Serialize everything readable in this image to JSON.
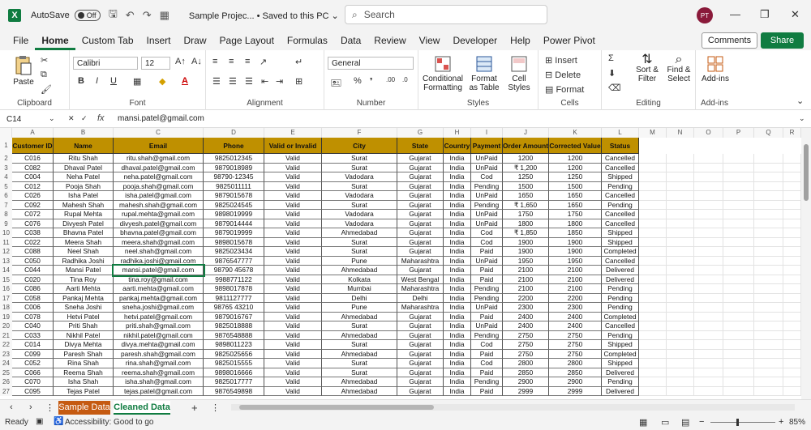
{
  "titlebar": {
    "app_logo": "X",
    "autosave_label": "AutoSave",
    "autosave_state": "Off",
    "doc_title": "Sample Projec... • Saved to this PC ⌄",
    "search_placeholder": "Search",
    "avatar_initials": "PT"
  },
  "tabs": [
    "File",
    "Home",
    "Custom Tab",
    "Insert",
    "Draw",
    "Page Layout",
    "Formulas",
    "Data",
    "Review",
    "View",
    "Developer",
    "Help",
    "Power Pivot"
  ],
  "active_tab": "Home",
  "comments_label": "Comments",
  "share_label": "Share",
  "ribbon": {
    "clipboard": {
      "paste": "Paste",
      "label": "Clipboard"
    },
    "font": {
      "name": "Calibri",
      "size": "12",
      "bold": "B",
      "italic": "I",
      "underline": "U",
      "font_color_letter": "A",
      "label": "Font"
    },
    "alignment": {
      "label": "Alignment"
    },
    "number": {
      "format": "General",
      "label": "Number"
    },
    "styles": {
      "conditional": "Conditional Formatting",
      "format_table": "Format as Table",
      "cell_styles": "Cell Styles",
      "label": "Styles"
    },
    "cells": {
      "insert": "Insert",
      "delete": "Delete",
      "format": "Format",
      "label": "Cells"
    },
    "editing": {
      "sort": "Sort & Filter",
      "find": "Find & Select",
      "label": "Editing"
    },
    "addins": {
      "addins": "Add-ins",
      "label": "Add-ins"
    }
  },
  "formula_bar": {
    "name_box": "C14",
    "fx": "fx",
    "content": "mansi.patel@gmail.com"
  },
  "columns": [
    "A",
    "B",
    "C",
    "D",
    "E",
    "F",
    "G",
    "H",
    "I",
    "J",
    "K",
    "L",
    "M",
    "N",
    "O",
    "P",
    "Q",
    "R"
  ],
  "headers": [
    "Customer ID",
    "Name",
    "Email",
    "Phone",
    "Valid or Invalid",
    "City",
    "State",
    "Country",
    "Payment",
    "Order Amount",
    "Corrected Value",
    "Status"
  ],
  "rows": [
    [
      "C016",
      "Ritu Shah",
      "ritu.shah@gmail.com",
      "9825012345",
      "Valid",
      "Surat",
      "Gujarat",
      "India",
      "UnPaid",
      "1200",
      "1200",
      "Cancelled"
    ],
    [
      "C082",
      "Dhaval Patel",
      "dhaval.patel@gmail.com",
      "9879018989",
      "Valid",
      "Surat",
      "Gujarat",
      "India",
      "UnPaid",
      "₹ 1,200",
      "1200",
      "Cancelled"
    ],
    [
      "C004",
      "Neha Patel",
      "neha.patel@gmail.com",
      "98790-12345",
      "Valid",
      "Vadodara",
      "Gujarat",
      "India",
      "Cod",
      "1250",
      "1250",
      "Shipped"
    ],
    [
      "C012",
      "Pooja Shah",
      "pooja.shah@gmail.com",
      "9825011111",
      "Valid",
      "Surat",
      "Gujarat",
      "India",
      "Pending",
      "1500",
      "1500",
      "Pending"
    ],
    [
      "C026",
      "Isha Patel",
      "isha.patel@gmail.com",
      "9879015678",
      "Valid",
      "Vadodara",
      "Gujarat",
      "India",
      "UnPaid",
      "1650",
      "1650",
      "Cancelled"
    ],
    [
      "C092",
      "Mahesh Shah",
      "mahesh.shah@gmail.com",
      "9825024545",
      "Valid",
      "Surat",
      "Gujarat",
      "India",
      "Pending",
      "₹ 1,650",
      "1650",
      "Pending"
    ],
    [
      "C072",
      "Rupal Mehta",
      "rupal.mehta@gmail.com",
      "9898019999",
      "Valid",
      "Vadodara",
      "Gujarat",
      "India",
      "UnPaid",
      "1750",
      "1750",
      "Cancelled"
    ],
    [
      "C076",
      "Divyesh Patel",
      "divyesh.patel@gmail.com",
      "9879014444",
      "Valid",
      "Vadodara",
      "Gujarat",
      "India",
      "UnPaid",
      "1800",
      "1800",
      "Cancelled"
    ],
    [
      "C038",
      "Bhavna Patel",
      "bhavna.patel@gmail.com",
      "9879019999",
      "Valid",
      "Ahmedabad",
      "Gujarat",
      "India",
      "Cod",
      "₹ 1,850",
      "1850",
      "Shipped"
    ],
    [
      "C022",
      "Meera Shah",
      "meera.shah@gmail.com",
      "9898015678",
      "Valid",
      "Surat",
      "Gujarat",
      "India",
      "Cod",
      "1900",
      "1900",
      "Shipped"
    ],
    [
      "C088",
      "Neel Shah",
      "neel.shah@gmail.com",
      "9825023434",
      "Valid",
      "Surat",
      "Gujarat",
      "India",
      "Paid",
      "1900",
      "1900",
      "Completed"
    ],
    [
      "C050",
      "Radhika Joshi",
      "radhika.joshi@gmail.com",
      "9876547777",
      "Valid",
      "Pune",
      "Maharashtra",
      "India",
      "UnPaid",
      "1950",
      "1950",
      "Cancelled"
    ],
    [
      "C044",
      "Mansi Patel",
      "mansi.patel@gmail.com",
      "98790 45678",
      "Valid",
      "Ahmedabad",
      "Gujarat",
      "India",
      "Paid",
      "2100",
      "2100",
      "Delivered"
    ],
    [
      "C020",
      "Tina Roy",
      "tina.roy@gmail.com",
      "9988771122",
      "Valid",
      "Kolkata",
      "West Bengal",
      "India",
      "Paid",
      "2100",
      "2100",
      "Delivered"
    ],
    [
      "C086",
      "Aarti Mehta",
      "aarti.mehta@gmail.com",
      "9898017878",
      "Valid",
      "Mumbai",
      "Maharashtra",
      "India",
      "Pending",
      "2100",
      "2100",
      "Pending"
    ],
    [
      "C058",
      "Pankaj Mehta",
      "pankaj.mehta@gmail.com",
      "9811127777",
      "Valid",
      "Delhi",
      "Delhi",
      "India",
      "Pending",
      "2200",
      "2200",
      "Pending"
    ],
    [
      "C006",
      "Sneha Joshi",
      "sneha.joshi@gmail.com",
      "98765 43210",
      "Valid",
      "Pune",
      "Maharashtra",
      "India",
      "UnPaid",
      "2300",
      "2300",
      "Pending"
    ],
    [
      "C078",
      "Hetvi Patel",
      "hetvi.patel@gmail.com",
      "9879016767",
      "Valid",
      "Ahmedabad",
      "Gujarat",
      "India",
      "Paid",
      "2400",
      "2400",
      "Completed"
    ],
    [
      "C040",
      "Priti Shah",
      "priti.shah@gmail.com",
      "9825018888",
      "Valid",
      "Surat",
      "Gujarat",
      "India",
      "UnPaid",
      "2400",
      "2400",
      "Cancelled"
    ],
    [
      "C033",
      "Nikhil Patel",
      "nikhil.patel@gmail.com",
      "9876548888",
      "Valid",
      "Ahmedabad",
      "Gujarat",
      "India",
      "Pending",
      "2750",
      "2750",
      "Pending"
    ],
    [
      "C014",
      "Divya Mehta",
      "divya.mehta@gmail.com",
      "9898011223",
      "Valid",
      "Surat",
      "Gujarat",
      "India",
      "Cod",
      "2750",
      "2750",
      "Shipped"
    ],
    [
      "C099",
      "Paresh Shah",
      "paresh.shah@gmail.com",
      "9825025656",
      "Valid",
      "Ahmedabad",
      "Gujarat",
      "India",
      "Paid",
      "2750",
      "2750",
      "Completed"
    ],
    [
      "C052",
      "Rina Shah",
      "rina.shah@gmail.com",
      "9825015555",
      "Valid",
      "Surat",
      "Gujarat",
      "India",
      "Cod",
      "2800",
      "2800",
      "Shipped"
    ],
    [
      "C066",
      "Reema Shah",
      "reema.shah@gmail.com",
      "9898016666",
      "Valid",
      "Surat",
      "Gujarat",
      "India",
      "Paid",
      "2850",
      "2850",
      "Delivered"
    ],
    [
      "C070",
      "Isha Shah",
      "isha.shah@gmail.com",
      "9825017777",
      "Valid",
      "Ahmedabad",
      "Gujarat",
      "India",
      "Pending",
      "2900",
      "2900",
      "Pending"
    ],
    [
      "C095",
      "Tejas Patel",
      "tejas.patel@gmail.com",
      "9876549898",
      "Valid",
      "Ahmedabad",
      "Gujarat",
      "India",
      "Paid",
      "2999",
      "2999",
      "Delivered"
    ]
  ],
  "sheets": [
    "Sample Data",
    "Cleaned Data"
  ],
  "active_sheet": "Cleaned Data",
  "status": {
    "ready": "Ready",
    "accessibility": "Accessibility: Good to go",
    "zoom": "85%"
  },
  "colors": {
    "excel_green": "#107c41",
    "header_fill": "#bf9000",
    "sample_tab": "#c55a11"
  }
}
